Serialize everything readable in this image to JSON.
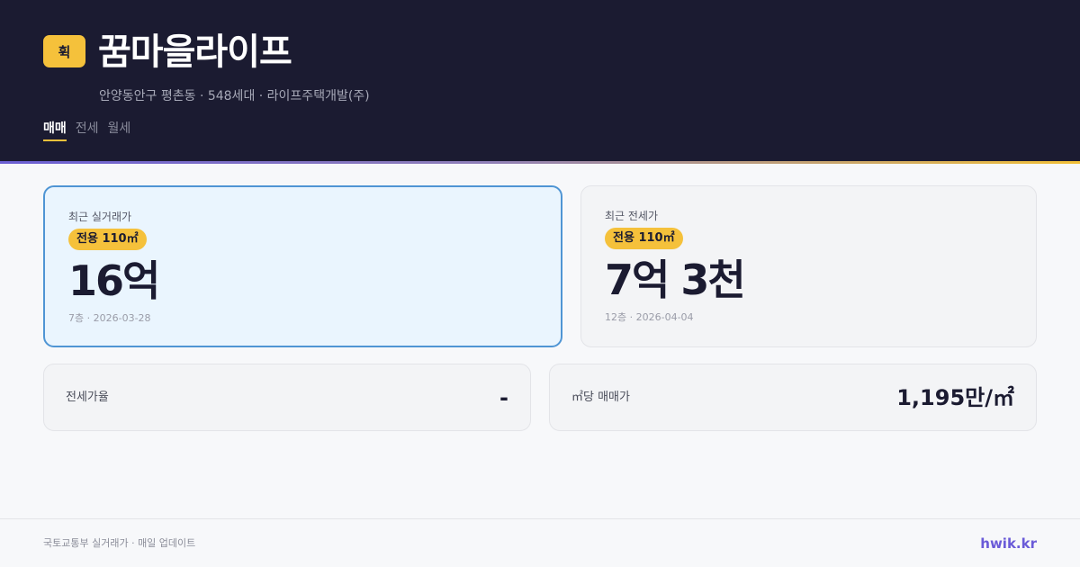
{
  "header": {
    "logo_text": "휙",
    "title": "꿈마을라이프",
    "subtitle": "안양동안구 평촌동 · 548세대 · 라이프주택개발(주)",
    "tabs": [
      "매매",
      "전세",
      "월세"
    ],
    "active_tab": "매매"
  },
  "cards": {
    "sale": {
      "label": "최근 실거래가",
      "area": "전용 110㎡",
      "price": "16억",
      "meta": "7층 · 2026-03-28"
    },
    "jeonse": {
      "label": "최근 전세가",
      "area": "전용 110㎡",
      "price": "7억 3천",
      "meta": "12층 · 2026-04-04"
    }
  },
  "stats": {
    "jeonse_ratio": {
      "label": "전세가율",
      "value": "-"
    },
    "price_per_m2": {
      "label": "㎡당 매매가",
      "value": "1,195만/㎡"
    }
  },
  "footer": {
    "source": "국토교통부 실거래가 · 매일 업데이트",
    "brand": "hwik.kr"
  },
  "colors": {
    "header_bg": "#1b1b31",
    "accent_yellow": "#f5c13b",
    "highlight_border": "#4f95d4",
    "brand": "#6a5bd8"
  }
}
